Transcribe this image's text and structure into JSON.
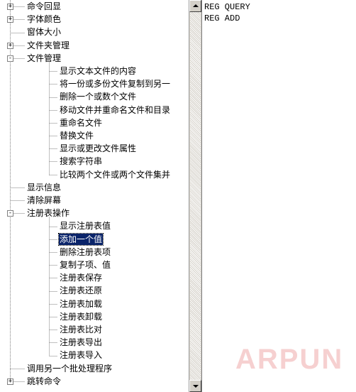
{
  "tree": {
    "items": [
      {
        "label": "命令回显",
        "level": 1,
        "expander": "+"
      },
      {
        "label": "字体颜色",
        "level": 1,
        "expander": "+"
      },
      {
        "label": "窗体大小",
        "level": 1,
        "expander": ""
      },
      {
        "label": "文件夹管理",
        "level": 1,
        "expander": "+"
      },
      {
        "label": "文件管理",
        "level": 1,
        "expander": "-"
      },
      {
        "label": "显示文本文件的内容",
        "level": 2,
        "expander": ""
      },
      {
        "label": "将一份或多份文件复制到另一",
        "level": 2,
        "expander": ""
      },
      {
        "label": "删除一个或数个文件",
        "level": 2,
        "expander": ""
      },
      {
        "label": "移动文件并重命名文件和目录",
        "level": 2,
        "expander": ""
      },
      {
        "label": "重命名文件",
        "level": 2,
        "expander": ""
      },
      {
        "label": "替换文件",
        "level": 2,
        "expander": ""
      },
      {
        "label": "显示或更改文件属性",
        "level": 2,
        "expander": ""
      },
      {
        "label": "搜索字符串",
        "level": 2,
        "expander": ""
      },
      {
        "label": "比较两个文件或两个文件集并",
        "level": 2,
        "expander": ""
      },
      {
        "label": "显示信息",
        "level": 1,
        "expander": ""
      },
      {
        "label": "清除屏幕",
        "level": 1,
        "expander": ""
      },
      {
        "label": "注册表操作",
        "level": 1,
        "expander": "-"
      },
      {
        "label": "显示注册表值",
        "level": 2,
        "expander": ""
      },
      {
        "label": "添加一个值",
        "level": 2,
        "expander": "",
        "selected": true
      },
      {
        "label": "删除注册表项",
        "level": 2,
        "expander": ""
      },
      {
        "label": "复制子项、值",
        "level": 2,
        "expander": ""
      },
      {
        "label": "注册表保存",
        "level": 2,
        "expander": ""
      },
      {
        "label": "注册表还原",
        "level": 2,
        "expander": ""
      },
      {
        "label": "注册表加载",
        "level": 2,
        "expander": ""
      },
      {
        "label": "注册表卸载",
        "level": 2,
        "expander": ""
      },
      {
        "label": "注册表比对",
        "level": 2,
        "expander": ""
      },
      {
        "label": "注册表导出",
        "level": 2,
        "expander": ""
      },
      {
        "label": "注册表导入",
        "level": 2,
        "expander": ""
      },
      {
        "label": "调用另一个批处理程序",
        "level": 1,
        "expander": ""
      },
      {
        "label": "跳转命令",
        "level": 1,
        "expander": "+"
      }
    ]
  },
  "editor": {
    "lines": [
      "REG QUERY",
      "REG ADD"
    ]
  },
  "watermark": "ARPUN",
  "colors": {
    "selection": "#0a246a",
    "scrollbar_face": "#d4d0c8",
    "tree_line": "#808080"
  }
}
